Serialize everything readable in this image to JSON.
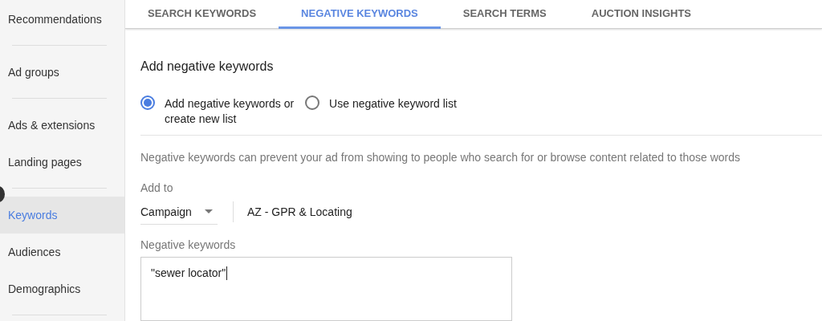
{
  "sidebar": {
    "groups": [
      {
        "items": [
          {
            "label": "Recommendations",
            "selected": false
          }
        ]
      },
      {
        "items": [
          {
            "label": "Ad groups",
            "selected": false
          }
        ]
      },
      {
        "items": [
          {
            "label": "Ads & extensions",
            "selected": false
          },
          {
            "label": "Landing pages",
            "selected": false
          }
        ]
      },
      {
        "items": [
          {
            "label": "Keywords",
            "selected": true
          },
          {
            "label": "Audiences",
            "selected": false
          },
          {
            "label": "Demographics",
            "selected": false
          }
        ]
      }
    ]
  },
  "tabs": [
    {
      "label": "SEARCH KEYWORDS",
      "selected": false
    },
    {
      "label": "NEGATIVE KEYWORDS",
      "selected": true
    },
    {
      "label": "SEARCH TERMS",
      "selected": false
    },
    {
      "label": "AUCTION INSIGHTS",
      "selected": false
    }
  ],
  "panel": {
    "title": "Add negative keywords",
    "options": [
      {
        "label": "Add negative keywords or\ncreate new list",
        "selected": true
      },
      {
        "label": "Use negative keyword list",
        "selected": false
      }
    ],
    "description": "Negative keywords can prevent your ad from showing to people who search for or browse content related to those words",
    "add_to": {
      "label": "Add to",
      "level_value": "Campaign",
      "campaign": "AZ - GPR & Locating"
    },
    "keywords": {
      "label": "Negative keywords",
      "value": "\"sewer locator\""
    }
  }
}
